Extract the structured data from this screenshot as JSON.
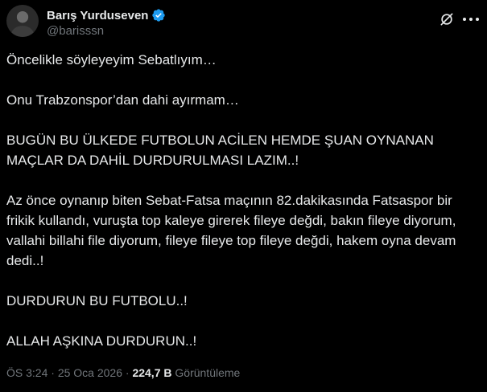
{
  "author": {
    "display_name": "Barış Yurduseven",
    "handle": "@barisssn"
  },
  "icons": {
    "avatar": "profile-photo",
    "verified": "verified-badge-icon",
    "grok": "grok-icon",
    "more": "more-options-icon"
  },
  "colors": {
    "background": "#000000",
    "text": "#e7e9ea",
    "secondary_text": "#71767b",
    "verified": "#1d9bf0"
  },
  "tweet": {
    "paragraphs": [
      "Öncelikle söyleyeyim Sebatlıyım…",
      "Onu Trabzonspor’dan dahi ayırmam…",
      "BUGÜN BU ÜLKEDE FUTBOLUN ACİLEN HEMDE ŞUAN OYNANAN MAÇLAR DA DAHİL DURDURULMASI LAZIM..!",
      "Az önce oynanıp biten Sebat-Fatsa maçının 82.dakikasında Fatsaspor bir frikik kullandı, vuruşta top kaleye girerek fileye değdi, bakın fileye diyorum, vallahi billahi file diyorum, fileye fileye top fileye değdi, hakem oyna devam dedi..!",
      "DURDURUN BU FUTBOLU..!",
      "ALLAH AŞKINA DURDURUN..!"
    ]
  },
  "meta": {
    "time": "ÖS 3:24",
    "separator1": " · ",
    "date": "25 Oca 2026",
    "separator2": " · ",
    "views_count": "224,7 B",
    "views_label": " Görüntüleme"
  }
}
